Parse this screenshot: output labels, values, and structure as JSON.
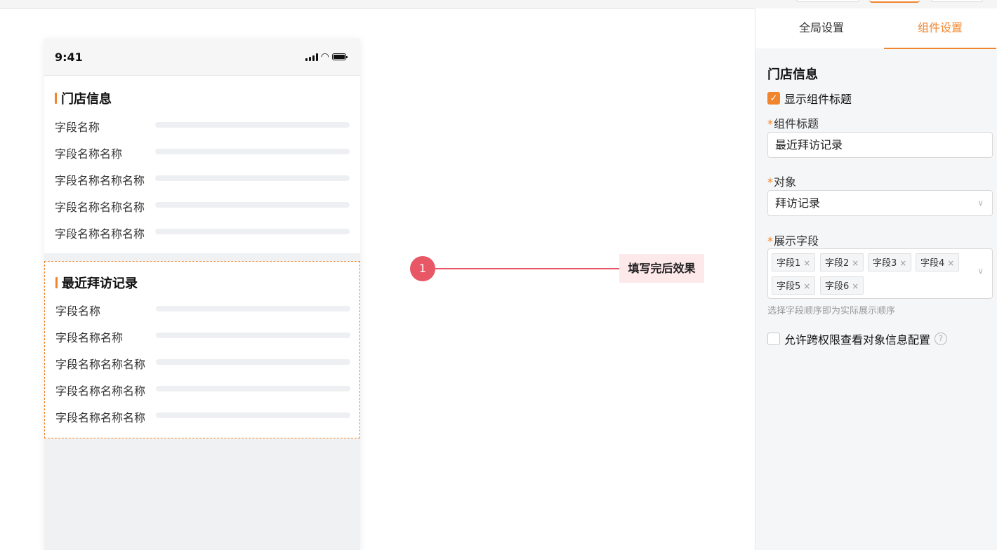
{
  "phone": {
    "time": "9:41",
    "store_card": {
      "title": "门店信息",
      "rows": [
        "字段名称",
        "字段名称名称",
        "字段名称名称名称",
        "字段名称名称名称",
        "字段名称名称名称"
      ]
    },
    "visit_card": {
      "title": "最近拜访记录",
      "rows": [
        "字段名称",
        "字段名称名称",
        "字段名称名称名称",
        "字段名称名称名称",
        "字段名称名称名称"
      ]
    }
  },
  "annotation": {
    "number": "1",
    "label": "填写完后效果"
  },
  "panel": {
    "tabs": [
      "全局设置",
      "组件设置"
    ],
    "active_tab": "组件设置",
    "section_title": "门店信息",
    "show_title_checkbox": {
      "label": "显示组件标题",
      "checked": true
    },
    "component_title": {
      "label": "组件标题",
      "value": "最近拜访记录"
    },
    "object": {
      "label": "对象",
      "value": "拜访记录"
    },
    "display_fields": {
      "label": "展示字段",
      "tags": [
        "字段1",
        "字段2",
        "字段3",
        "字段4",
        "字段5",
        "字段6"
      ],
      "hint": "选择字段顺序即为实际展示顺序"
    },
    "cross_permission": {
      "label": "允许跨权限查看对象信息配置",
      "checked": false
    },
    "required_mark": "*",
    "tag_remove": "×"
  },
  "colors": {
    "accent": "#f0852d",
    "annotation": "#e85766",
    "annotation_bg": "#fde8ea"
  }
}
